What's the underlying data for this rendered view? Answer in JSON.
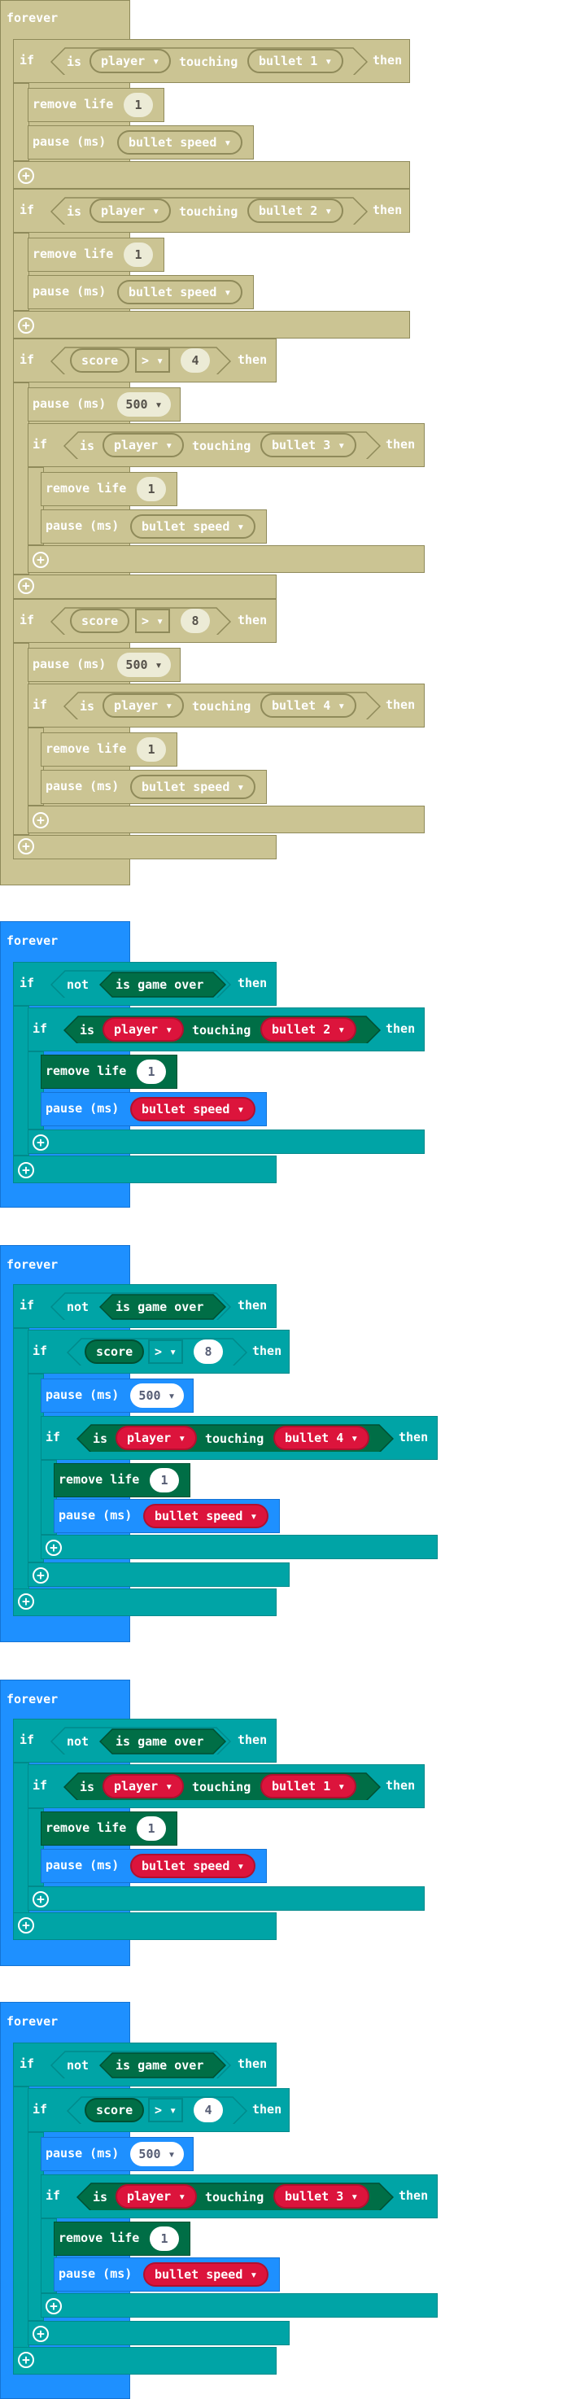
{
  "keywords": {
    "forever": "forever",
    "if": "if",
    "then": "then",
    "is": "is",
    "touching": "touching",
    "not": "not",
    "remove_life": "remove life",
    "pause": "pause (ms)"
  },
  "values": {
    "player": "player",
    "bullet1": "bullet 1",
    "bullet2": "bullet 2",
    "bullet3": "bullet 3",
    "bullet4": "bullet 4",
    "bullet_speed": "bullet speed",
    "score": "score",
    "gt": ">",
    "one": "1",
    "four": "4",
    "eight": "8",
    "five_hundred": "500",
    "is_game_over": "is game over"
  },
  "icons": {
    "dropdown": "▾",
    "add": "+"
  },
  "colors": {
    "forever_blue": "#1e90ff",
    "logic_teal": "#00a4a6",
    "life_green": "#006e46",
    "sprite_red": "#dc143c",
    "disabled_tan": "#cbc493"
  }
}
